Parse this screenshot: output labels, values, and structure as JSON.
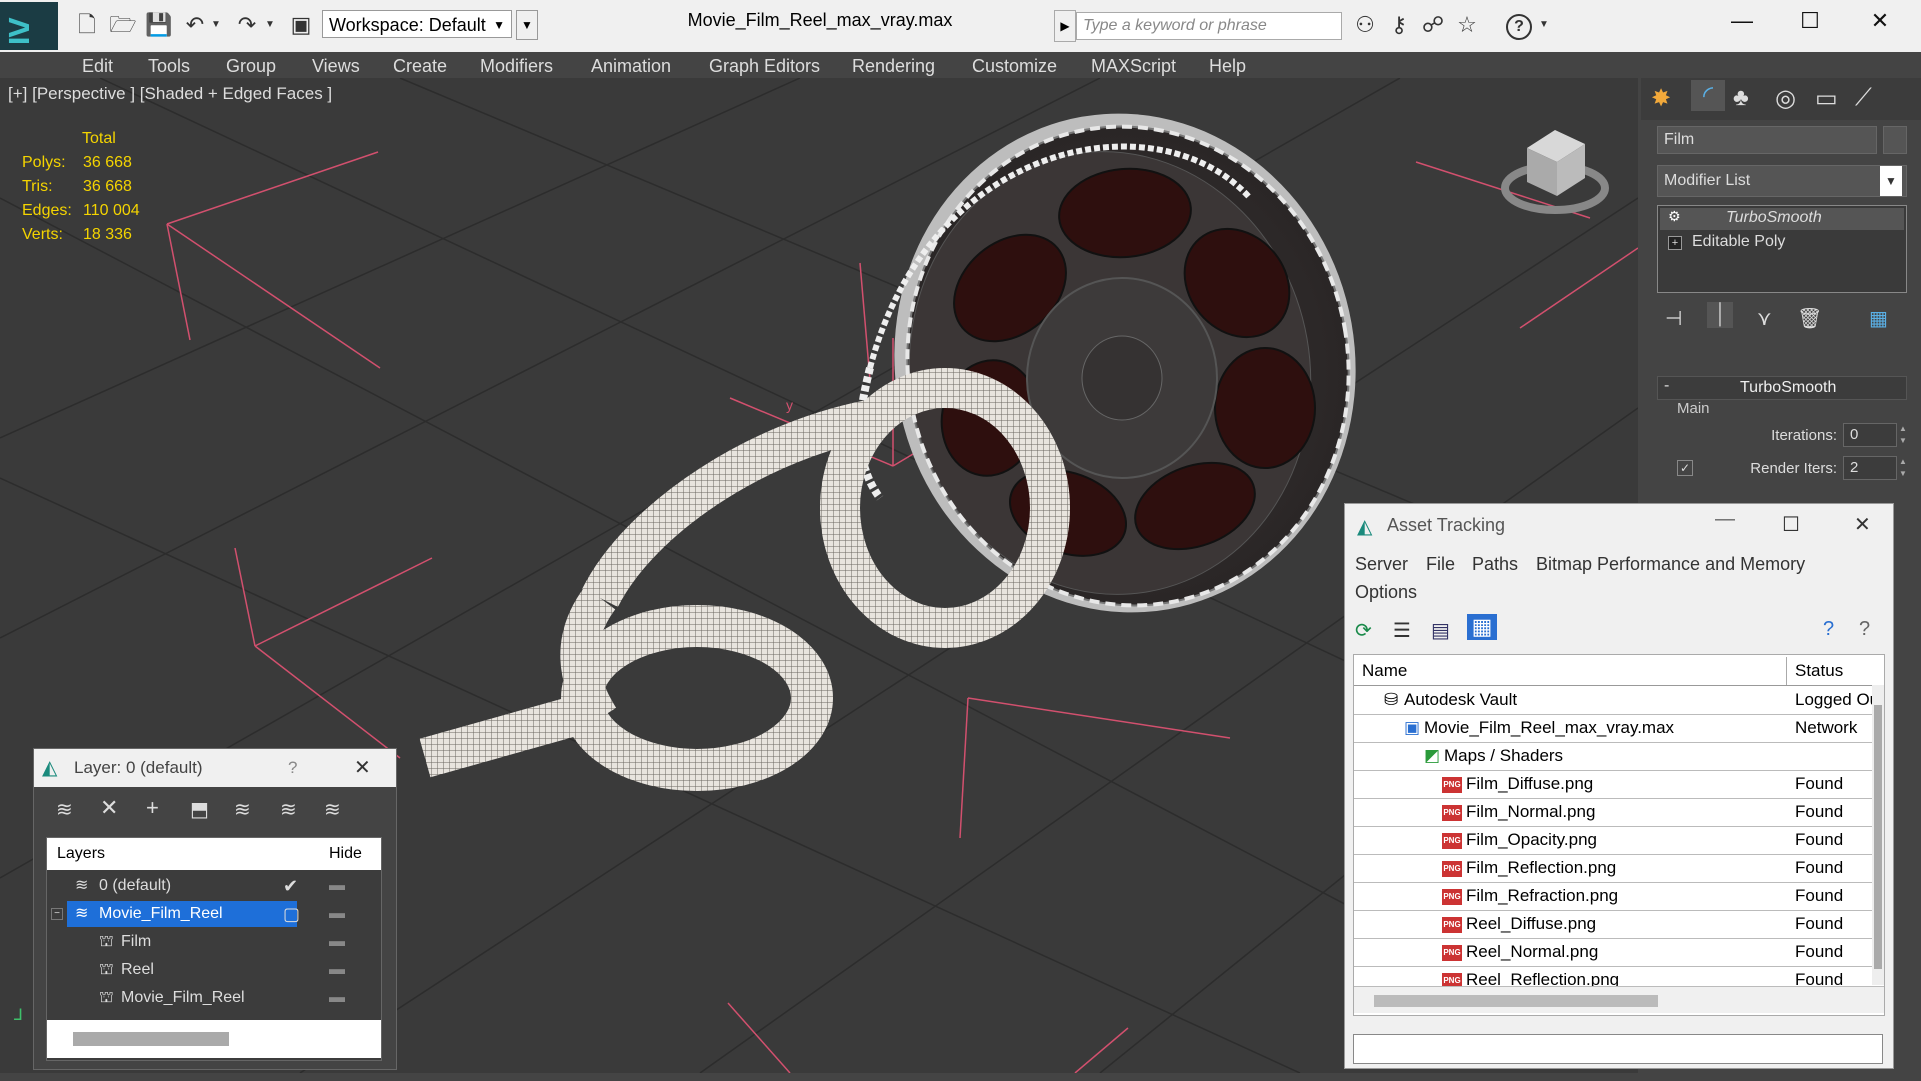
{
  "titlebar": {
    "workspace": "Workspace: Default",
    "document_title": "Movie_Film_Reel_max_vray.max",
    "search_placeholder": "Type a keyword or phrase",
    "help_label": "?"
  },
  "menu": [
    "Edit",
    "Tools",
    "Group",
    "Views",
    "Create",
    "Modifiers",
    "Animation",
    "Graph Editors",
    "Rendering",
    "Customize",
    "MAXScript",
    "Help"
  ],
  "viewport": {
    "label": "[+] [Perspective ] [Shaded + Edged Faces ]",
    "stats": {
      "header": "Total",
      "rows": [
        {
          "label": "Polys:",
          "value": "36 668"
        },
        {
          "label": "Tris:",
          "value": "36 668"
        },
        {
          "label": "Edges:",
          "value": "110 004"
        },
        {
          "label": "Verts:",
          "value": "18 336"
        }
      ]
    },
    "axis_y": "y"
  },
  "command_panel": {
    "object_name": "Film",
    "modifier_list": "Modifier List",
    "stack": [
      "TurboSmooth",
      "Editable Poly"
    ],
    "rollout_title": "TurboSmooth",
    "section_main": "Main",
    "collapse": "-",
    "iterations_label": "Iterations:",
    "iterations_value": "0",
    "render_iters_label": "Render Iters:",
    "render_iters_value": "2"
  },
  "asset_tracking": {
    "title": "Asset Tracking",
    "menu": [
      "Server",
      "File",
      "Paths",
      "Bitmap Performance and Memory",
      "Options"
    ],
    "columns": [
      "Name",
      "Status"
    ],
    "rows": [
      {
        "name": "Autodesk Vault",
        "status": "Logged Out",
        "indent": 0
      },
      {
        "name": "Movie_Film_Reel_max_vray.max",
        "status": "Network",
        "indent": 1
      },
      {
        "name": "Maps / Shaders",
        "status": "",
        "indent": 2
      },
      {
        "name": "Film_Diffuse.png",
        "status": "Found",
        "indent": 3
      },
      {
        "name": "Film_Normal.png",
        "status": "Found",
        "indent": 3
      },
      {
        "name": "Film_Opacity.png",
        "status": "Found",
        "indent": 3
      },
      {
        "name": "Film_Reflection.png",
        "status": "Found",
        "indent": 3
      },
      {
        "name": "Film_Refraction.png",
        "status": "Found",
        "indent": 3
      },
      {
        "name": "Reel_Diffuse.png",
        "status": "Found",
        "indent": 3
      },
      {
        "name": "Reel_Normal.png",
        "status": "Found",
        "indent": 3
      },
      {
        "name": "Reel_Reflection.png",
        "status": "Found",
        "indent": 3
      }
    ],
    "png_badge": "PNG"
  },
  "layer_window": {
    "title": "Layer: 0 (default)",
    "help": "?",
    "columns": [
      "Layers",
      "Hide"
    ],
    "rows": [
      {
        "name": "0 (default)",
        "indent": 1,
        "selected": false
      },
      {
        "name": "Movie_Film_Reel",
        "indent": 1,
        "selected": true
      },
      {
        "name": "Film",
        "indent": 2,
        "selected": false
      },
      {
        "name": "Reel",
        "indent": 2,
        "selected": false
      },
      {
        "name": "Movie_Film_Reel",
        "indent": 2,
        "selected": false
      }
    ]
  },
  "colors": {
    "accent_blue": "#1e6fd9",
    "stat_yellow": "#f4d400",
    "grid_pink": "#e0607a",
    "viewport_bg": "#3a3a3a"
  }
}
